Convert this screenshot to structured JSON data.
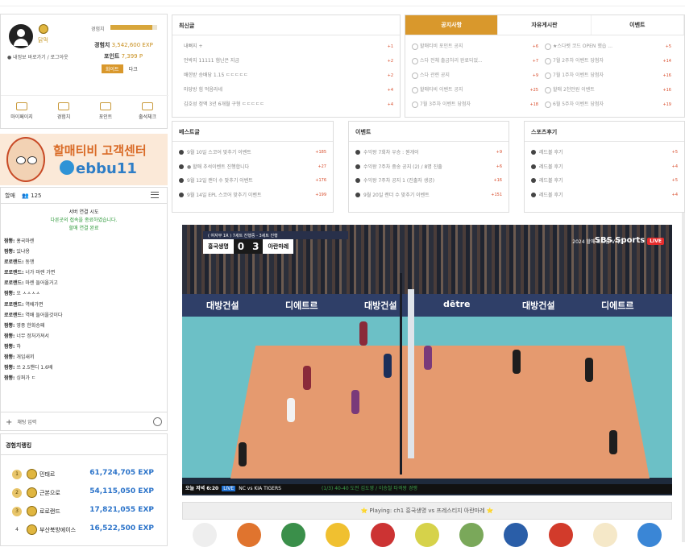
{
  "profile": {
    "nickname": "닭먹",
    "my_links": "● 내정보 바로가기 / 로그아웃",
    "exp_label": "경험치",
    "exp_fraction": 0.9,
    "exp_title": "경험치",
    "exp_value": "3,542,600 EXP",
    "point_title": "포인트",
    "point_value": "7,399 P",
    "theme_light": "화이트",
    "theme_dark": "다크",
    "nav": [
      "마이페이지",
      "경험치",
      "포인트",
      "출석체크"
    ]
  },
  "banner": {
    "title": "할매티비 고객센터",
    "handle": "ebbu11"
  },
  "chat": {
    "title": "할매",
    "user_count": "125",
    "sys1": "서버 연결 시도",
    "sys2": "다른곳의 접속을 종료하였습니다.",
    "sys3": "할매 연결 완료",
    "messages": [
      {
        "user": "짬뽕:",
        "text": "홍국마렌"
      },
      {
        "user": "짬뽕:",
        "text": "있냐용"
      },
      {
        "user": "로로랜드:",
        "text": "동맹"
      },
      {
        "user": "로로랜드:",
        "text": "너가 마렌 가면"
      },
      {
        "user": "로로랜드:",
        "text": "마렌 들어올거고"
      },
      {
        "user": "짬뽕:",
        "text": "오 ㅅㅅㅅㅅ"
      },
      {
        "user": "로로랜드:",
        "text": "역배가면"
      },
      {
        "user": "로로랜드:",
        "text": "역배 들어올것이다"
      },
      {
        "user": "짬뽕:",
        "text": "영중 한화승패"
      },
      {
        "user": "짬뽕:",
        "text": "너무 정처가져서"
      },
      {
        "user": "짬뽕:",
        "text": "하"
      },
      {
        "user": "짬뽕:",
        "text": "개임새끼"
      },
      {
        "user": "짬뽕:",
        "text": "쓰 2.5핸디 1.6배"
      },
      {
        "user": "짬뽕:",
        "text": "싱퍼가 ㄷ"
      }
    ],
    "input_placeholder": "채팅 입력"
  },
  "ranking": {
    "title": "경험치랭킹",
    "rows": [
      {
        "num": "1",
        "name": "민태르",
        "exp": "61,724,705 EXP"
      },
      {
        "num": "2",
        "name": "근본으로",
        "exp": "54,115,050 EXP"
      },
      {
        "num": "3",
        "name": "로로랜드",
        "exp": "17,821,055 EXP"
      },
      {
        "num": "4",
        "name": "부산북방에이스",
        "exp": "16,522,500 EXP"
      }
    ]
  },
  "latest": {
    "title": "최신글",
    "items": [
      {
        "t": "내뻐지 +",
        "c": "+1"
      },
      {
        "t": "언박지 11111 험닌은 지금",
        "c": "+2"
      },
      {
        "t": "배힌받 승배당 1.15 ㄷㄷㄷㄷㄷ",
        "c": "+2"
      },
      {
        "t": "마당방 힘 먹음라네",
        "c": "+4"
      },
      {
        "t": "김호성 정액 3년 6개월 구형 ㄷㄷㄷㄷㄷ",
        "c": "+4"
      }
    ]
  },
  "notice": {
    "tabs": [
      "공지사항",
      "자유게시판",
      "이벤트"
    ],
    "left": [
      {
        "t": "할매티비 포인트 공지",
        "c": "+6"
      },
      {
        "t": "스다 전체 출금처리 완료되었...",
        "c": "+7"
      },
      {
        "t": "스다 관련 공지",
        "c": "+9"
      },
      {
        "t": "할매티비 이벤트 공지",
        "c": "+25"
      },
      {
        "t": "7월 3주차 이벤트 당첨자",
        "c": "+18"
      }
    ],
    "right": [
      {
        "t": "★스다벳 코드 OPEN 했습 ...",
        "c": "+5"
      },
      {
        "t": "7월 2주차 이벤트 당첨자",
        "c": "+14"
      },
      {
        "t": "7월 1주차 이벤트 당첨자",
        "c": "+16"
      },
      {
        "t": "할매 2천만원 이벤트",
        "c": "+16"
      },
      {
        "t": "6월 5주차 이벤트 당첨자",
        "c": "+19"
      }
    ]
  },
  "best": {
    "title": "베스트글",
    "items": [
      {
        "t": "9월 10일 스코어 맞추기 이벤트",
        "c": "+185"
      },
      {
        "t": "● 할매 추석이벤트 진행합니다",
        "c": "+27"
      },
      {
        "t": "9월 12일 랜더 수 맞추기 이벤트",
        "c": "+176"
      },
      {
        "t": "9월 14일 EPL 스코어 맞추기 이벤트",
        "c": "+199"
      }
    ]
  },
  "event": {
    "title": "이벤트",
    "items": [
      {
        "t": "수익왕 7회차 우승 : 뭔개이",
        "c": "+9"
      },
      {
        "t": "수익왕 7주차 중송 공지 (2) / 8명 진출",
        "c": "+6"
      },
      {
        "t": "수익왕 7주차 공지 1 (진출자 생공)",
        "c": "+16"
      },
      {
        "t": "9월 20일 랜더 수 맞추기 이벤트",
        "c": "+151"
      }
    ]
  },
  "sports": {
    "title": "스포츠후기",
    "items": [
      {
        "t": "레드볼 후기",
        "c": "+5"
      },
      {
        "t": "레드볼 후기",
        "c": "+4"
      },
      {
        "t": "레드볼 후기",
        "c": "+5"
      },
      {
        "t": "레드볼 후기",
        "c": "+4"
      }
    ]
  },
  "video": {
    "score_title": "( 여자부 1R ) 7세트 진행중 - 3세트 진행",
    "team1": "흥국생명",
    "score1": "0",
    "team2": "아란마레",
    "score2": "3",
    "league": "2024 할매 도드람 V리그",
    "broadcaster": "SBS Sports",
    "live": "LIVE",
    "ads": [
      "대방건설",
      "디에트르",
      "대방건설",
      "dētre",
      "대방건설",
      "디에트르"
    ],
    "ticker_time": "오늘 저녁 6:20",
    "ticker_live": "LIVE",
    "ticker_teams": "NC vs KIA TIGERS",
    "ticker_score": "(1/3) 40-40 도전 김도영 / 이승철 타격왕 경쟁",
    "playing": "⭐ Playing: ch1 흥국생명 vs 프레스티지 아란마레 ⭐"
  },
  "colors": {
    "accent": "#d9982c",
    "rank_blue": "#2b73c9",
    "count_red": "#d84b2a"
  },
  "sport_icons": [
    "soccer-icon",
    "basketball-icon",
    "baseball-icon",
    "volleyball-icon",
    "goal-icon",
    "tennis-icon",
    "golf-icon",
    "esports-icon",
    "tv-icon",
    "retro-tv-icon",
    "refresh-icon"
  ]
}
